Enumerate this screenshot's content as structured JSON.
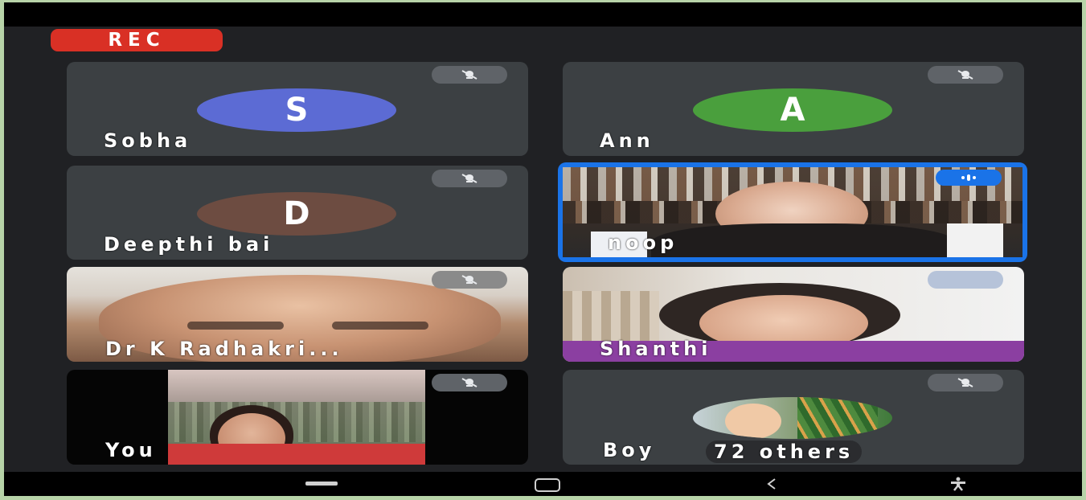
{
  "recording": {
    "label": "REC",
    "color": "#d93025"
  },
  "participants": [
    {
      "name": "Sobha",
      "initial": "S",
      "avatar_color": "#5c6bd4",
      "muted": true
    },
    {
      "name": "Ann",
      "initial": "A",
      "avatar_color": "#4a9f3d",
      "muted": true
    },
    {
      "name": "Deepthi bai",
      "initial": "D",
      "avatar_color": "#6d4c41",
      "muted": true
    },
    {
      "name": "noop",
      "video": true,
      "speaking": true,
      "highlight_color": "#1a73e8"
    },
    {
      "name": "Dr K Radhakri...",
      "video": true,
      "muted": true
    },
    {
      "name": "Shanthi",
      "video": true
    },
    {
      "name": "You",
      "video": true,
      "muted": true
    },
    {
      "name": "Boy",
      "others": "72 others",
      "muted": true
    }
  ],
  "icons": {
    "mute": "mic-off-icon",
    "speaking": "audio-level-icon",
    "nav": [
      "recents-icon",
      "home-icon",
      "back-icon",
      "accessibility-icon"
    ]
  }
}
